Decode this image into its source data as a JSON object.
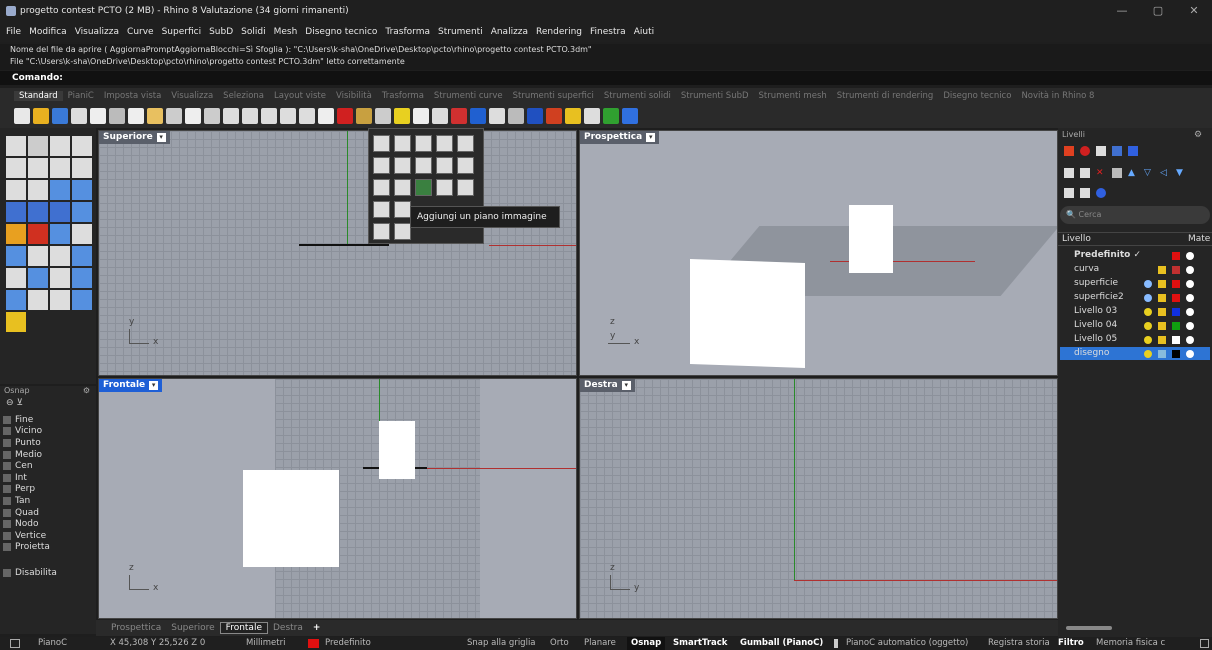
{
  "window": {
    "title": "progetto contest PCTO (2 MB) - Rhino 8 Valutazione (34 giorni rimanenti)"
  },
  "menu": [
    "File",
    "Modifica",
    "Visualizza",
    "Curve",
    "Superfici",
    "SubD",
    "Solidi",
    "Mesh",
    "Disegno tecnico",
    "Trasforma",
    "Strumenti",
    "Analizza",
    "Rendering",
    "Finestra",
    "Aiuti"
  ],
  "command_history": [
    "Nome del file da aprire ( AggiornaPromptAggiornaBlocchi=Sì  Sfoglia ): \"C:\\Users\\k-sha\\OneDrive\\Desktop\\pcto\\rhino\\progetto contest PCTO.3dm\"",
    "File \"C:\\Users\\k-sha\\OneDrive\\Desktop\\pcto\\rhino\\progetto contest PCTO.3dm\" letto correttamente"
  ],
  "command_prompt": "Comando:",
  "toolbar_tabs": [
    "Standard",
    "PianiC",
    "Imposta vista",
    "Visualizza",
    "Seleziona",
    "Layout viste",
    "Visibilità",
    "Trasforma",
    "Strumenti curve",
    "Strumenti superfici",
    "Strumenti solidi",
    "Strumenti SubD",
    "Strumenti mesh",
    "Strumenti di rendering",
    "Disegno tecnico",
    "Novità in Rhino 8"
  ],
  "viewports": {
    "top": {
      "label": "Superiore",
      "axis_y": "y",
      "axis_x": "x"
    },
    "perspective": {
      "label": "Prospettica",
      "axis_y": "z",
      "axis_x": "x",
      "axis_x2": "y"
    },
    "front": {
      "label": "Frontale",
      "axis_y": "z",
      "axis_x": "x"
    },
    "right": {
      "label": "Destra",
      "axis_y": "z",
      "axis_x": "y"
    }
  },
  "tooltip": "Aggiungi un piano immagine",
  "osnap": {
    "title": "Osnap",
    "items": [
      "Fine",
      "Vicino",
      "Punto",
      "Medio",
      "Cen",
      "Int",
      "Perp",
      "Tan",
      "Quad",
      "Nodo",
      "Vertice",
      "Proietta"
    ],
    "disable": "Disabilita"
  },
  "layers_panel": {
    "title": "Livelli",
    "search_placeholder": "Cerca",
    "col_layer": "Livello",
    "col_material": "Mate",
    "layers": [
      {
        "name": "Predefinito ✓",
        "color": "#e01010"
      },
      {
        "name": "curva",
        "color": "#c03030"
      },
      {
        "name": "superficie",
        "color": "#e01010"
      },
      {
        "name": "superficie2",
        "color": "#e01010"
      },
      {
        "name": "Livello 03",
        "color": "#1030e0"
      },
      {
        "name": "Livello 04",
        "color": "#10a010"
      },
      {
        "name": "Livello 05",
        "color": "#ffffff"
      },
      {
        "name": "disegno",
        "color": "#000000"
      }
    ]
  },
  "viewport_tabs": [
    "Prospettica",
    "Superiore",
    "Frontale",
    "Destra",
    "+"
  ],
  "status": {
    "plane": "PianoC",
    "coords": "X 45,308 Y 25,526 Z 0",
    "units": "Millimetri",
    "layer": "Predefinito",
    "snap_grid": "Snap alla griglia",
    "orto": "Orto",
    "planare": "Planare",
    "osnap": "Osnap",
    "smarttrack": "SmartTrack",
    "gumball": "Gumball (PianoC)",
    "auto_cplane": "PianoC automatico (oggetto)",
    "history": "Registra storia",
    "filter": "Filtro",
    "memory": "Memoria fisica c"
  }
}
